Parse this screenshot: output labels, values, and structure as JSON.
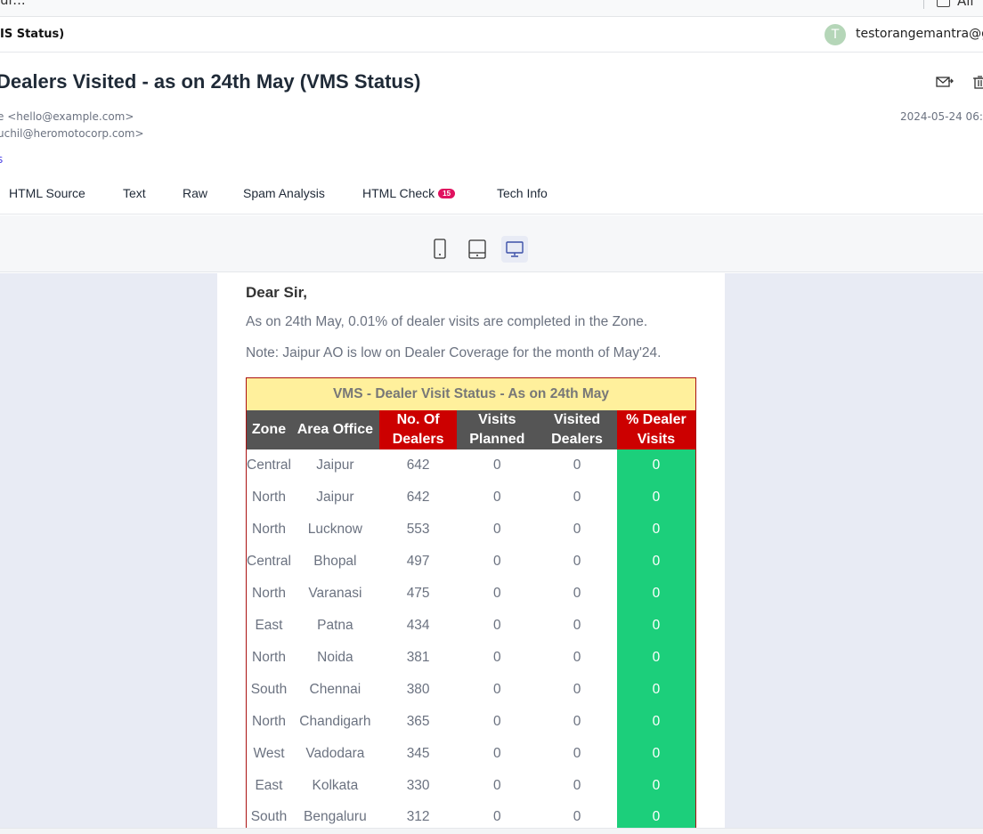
{
  "top": {
    "crumb": "ur...",
    "all_label": "All"
  },
  "subject_bar": {
    "short_subject": "IS Status)",
    "avatar_letter": "T",
    "account": "testorangemantra@gm"
  },
  "message": {
    "title": "Dealers Visited - as on 24th May (VMS Status)",
    "from": "e <hello@example.com>",
    "to": "uchil@heromotocorp.com>",
    "link": "s",
    "date": "2024-05-24 06:"
  },
  "tabs": [
    {
      "label": "HTML Source"
    },
    {
      "label": "Text"
    },
    {
      "label": "Raw"
    },
    {
      "label": "Spam Analysis"
    },
    {
      "label": "HTML Check",
      "badge": "15"
    },
    {
      "label": "Tech Info"
    }
  ],
  "devices": [
    "mobile-icon",
    "tablet-icon",
    "desktop-icon"
  ],
  "email": {
    "greeting": "Dear Sir,",
    "line1": "As on 24th May, 0.01% of dealer visits are completed in the Zone.",
    "line2": "Note: Jaipur AO is low on Dealer Coverage for the month of May'24.",
    "table": {
      "caption": "VMS - Dealer Visit Status - As on 24th May",
      "headers": {
        "zone": "Zone",
        "area": "Area Office",
        "dealers_1": "No. Of",
        "dealers_2": "Dealers",
        "planned_1": "Visits",
        "planned_2": "Planned",
        "visited_1": "Visited",
        "visited_2": "Dealers",
        "pct_1": "% Dealer",
        "pct_2": "Visits"
      },
      "rows": [
        {
          "zone": "Central",
          "area": "Jaipur",
          "dealers": "642",
          "planned": "0",
          "visited": "0",
          "pct": "0"
        },
        {
          "zone": "North",
          "area": "Jaipur",
          "dealers": "642",
          "planned": "0",
          "visited": "0",
          "pct": "0"
        },
        {
          "zone": "North",
          "area": "Lucknow",
          "dealers": "553",
          "planned": "0",
          "visited": "0",
          "pct": "0"
        },
        {
          "zone": "Central",
          "area": "Bhopal",
          "dealers": "497",
          "planned": "0",
          "visited": "0",
          "pct": "0"
        },
        {
          "zone": "North",
          "area": "Varanasi",
          "dealers": "475",
          "planned": "0",
          "visited": "0",
          "pct": "0"
        },
        {
          "zone": "East",
          "area": "Patna",
          "dealers": "434",
          "planned": "0",
          "visited": "0",
          "pct": "0"
        },
        {
          "zone": "North",
          "area": "Noida",
          "dealers": "381",
          "planned": "0",
          "visited": "0",
          "pct": "0"
        },
        {
          "zone": "South",
          "area": "Chennai",
          "dealers": "380",
          "planned": "0",
          "visited": "0",
          "pct": "0"
        },
        {
          "zone": "North",
          "area": "Chandigarh",
          "dealers": "365",
          "planned": "0",
          "visited": "0",
          "pct": "0"
        },
        {
          "zone": "West",
          "area": "Vadodara",
          "dealers": "345",
          "planned": "0",
          "visited": "0",
          "pct": "0"
        },
        {
          "zone": "East",
          "area": "Kolkata",
          "dealers": "330",
          "planned": "0",
          "visited": "0",
          "pct": "0"
        },
        {
          "zone": "South",
          "area": "Bengaluru",
          "dealers": "312",
          "planned": "0",
          "visited": "0",
          "pct": "0"
        }
      ]
    }
  },
  "colors": {
    "caption_bg": "#fff09c",
    "header_dark": "#555555",
    "header_red": "#cc0000",
    "pct_green": "#1ccf7b",
    "preview_bg": "#e8ebf4",
    "badge": "#e0115f"
  }
}
